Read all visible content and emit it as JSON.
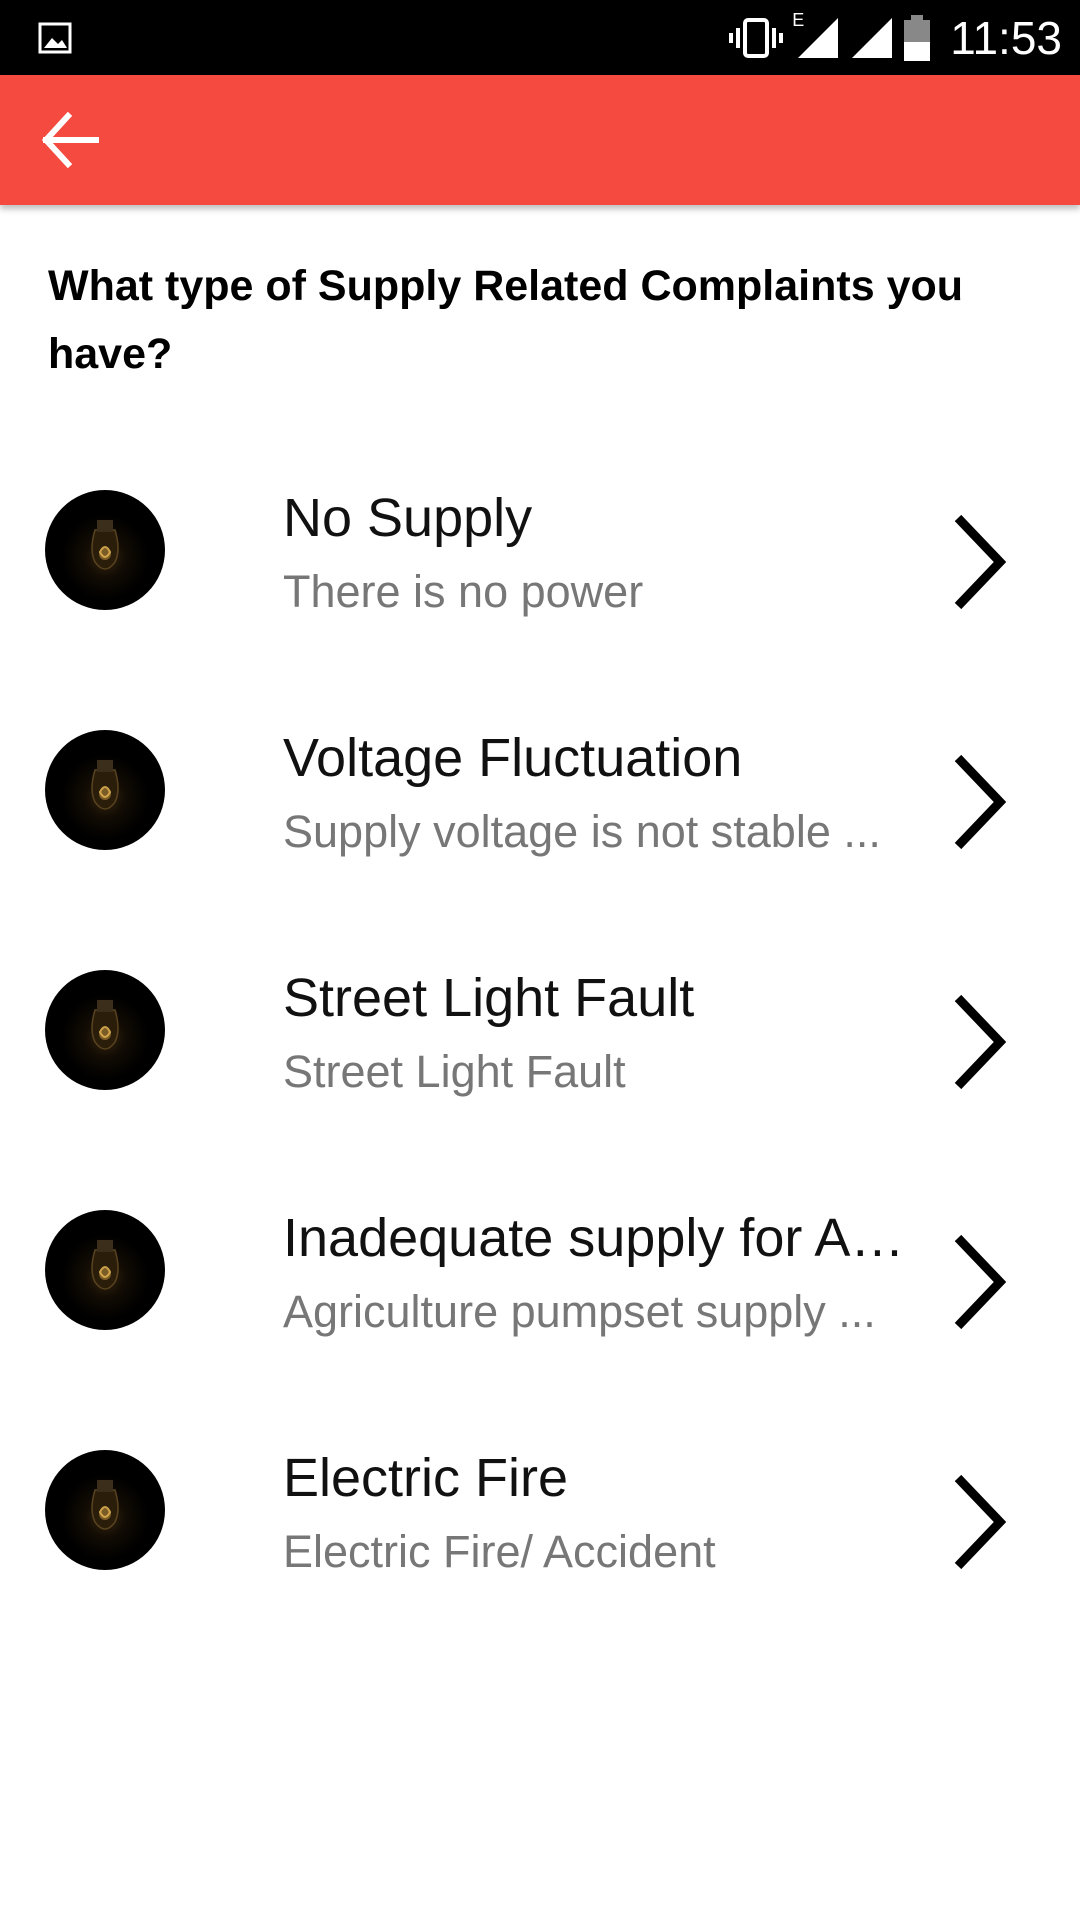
{
  "status_bar": {
    "time": "11:53",
    "network_label": "E",
    "icons": [
      "gallery-notification-icon",
      "vibrate-icon",
      "signal-icon",
      "signal-icon",
      "battery-icon"
    ]
  },
  "app_bar": {
    "color": "#f44a3f",
    "back_icon": "arrow-left-icon"
  },
  "question": "What type of Supply Related Complaints you have?",
  "complaints": [
    {
      "title": "No Supply",
      "subtitle": "There is no power",
      "icon": "light-bulb-icon"
    },
    {
      "title": "Voltage Fluctuation",
      "subtitle": "Supply voltage is not stable ...",
      "icon": "light-bulb-icon"
    },
    {
      "title": "Street Light Fault",
      "subtitle": "Street Light Fault",
      "icon": "light-bulb-icon"
    },
    {
      "title": "Inadequate supply for Ag...",
      "subtitle": "Agriculture pumpset supply ...",
      "icon": "light-bulb-icon"
    },
    {
      "title": "Electric Fire",
      "subtitle": "Electric Fire/ Accident",
      "icon": "light-bulb-icon"
    }
  ]
}
